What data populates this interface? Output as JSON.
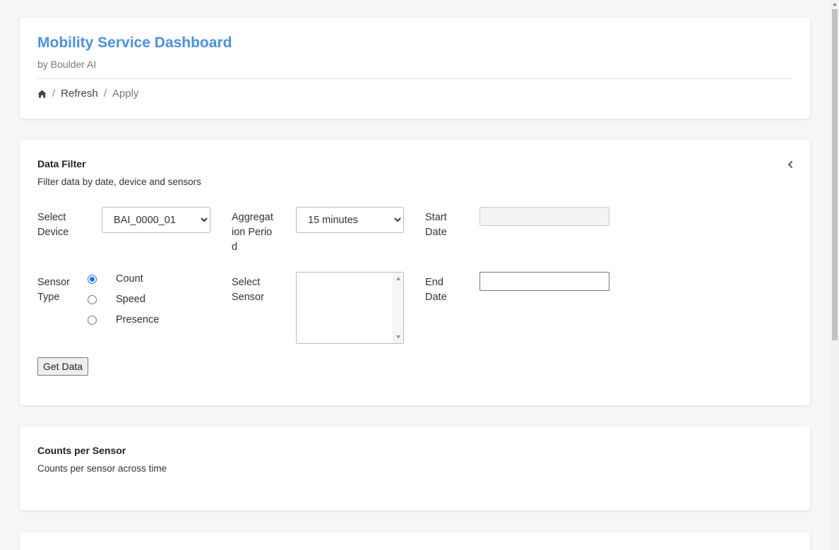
{
  "header": {
    "title": "Mobility Service Dashboard",
    "subtitle": "by Boulder AI",
    "breadcrumb": {
      "home_icon": "home-icon",
      "separator": "/",
      "items": [
        {
          "label": "Refresh"
        },
        {
          "label": "Apply"
        }
      ]
    }
  },
  "filter": {
    "title": "Data Filter",
    "description": "Filter data by date, device and sensors",
    "collapse_icon": "chevron-left-icon",
    "device_label": "Select Device",
    "device_value": "BAI_0000_01",
    "aggregation_label": "Aggregation Period",
    "aggregation_value": "15 minutes",
    "start_date_label": "Start Date",
    "start_date_value": "",
    "end_date_label": "End Date",
    "end_date_value": "",
    "sensor_type_label": "Sensor Type",
    "sensor_types": [
      {
        "label": "Count",
        "checked": true
      },
      {
        "label": "Speed",
        "checked": false
      },
      {
        "label": "Presence",
        "checked": false
      }
    ],
    "select_sensor_label": "Select Sensor",
    "get_data_label": "Get Data"
  },
  "counts": {
    "title": "Counts per Sensor",
    "description": "Counts per sensor across time"
  },
  "colors": {
    "accent": "#4a90e2",
    "radio_checked": "#1a73e8",
    "background": "#f5f6f8"
  }
}
